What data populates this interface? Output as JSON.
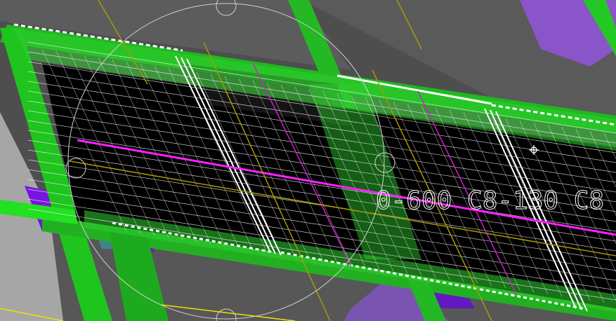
{
  "viewport": {
    "background": "#4a4a4a",
    "annotation_text": "0-600 C8-130 C8",
    "colors": {
      "slab_dark": "#5a5a5a",
      "beam_green": "#1fc41f",
      "beam_green_bright": "#22e022",
      "mesh_black": "#000000",
      "rebar_white": "#ffffff",
      "magenta_line": "#ff22ff",
      "olive_line": "#b0a000",
      "purple_block": "#7b2bd6",
      "teal_block": "#3d8a8a",
      "yellow_line": "#e6e600",
      "lightgray_panel": "#a0a0a0"
    },
    "icons": {
      "cursor": "move-cursor-icon",
      "ucs": "ucs-circle-icon"
    }
  }
}
